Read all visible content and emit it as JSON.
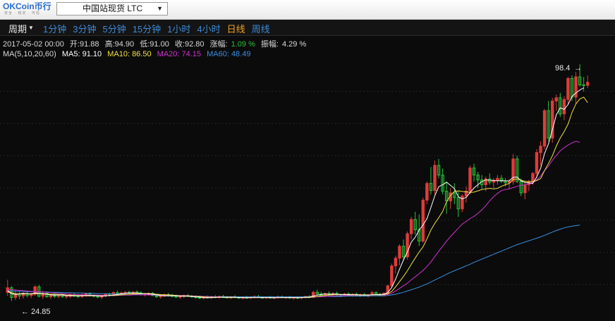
{
  "app": {
    "logo_text": "OKCoin币行",
    "logo_subtitle": "安全 · 稳定 · 可信",
    "market": "中国站现货 LTC"
  },
  "period": {
    "label": "周期",
    "tabs": [
      "1分钟",
      "3分钟",
      "5分钟",
      "15分钟",
      "1小时",
      "4小时",
      "日线",
      "周线"
    ],
    "active": "日线"
  },
  "info": {
    "datetime": "2017-05-02 00:00",
    "open_label": "开:",
    "open": "91.88",
    "high_label": "高:",
    "high": "94.90",
    "low_label": "低:",
    "low": "91.00",
    "close_label": "收:",
    "close": "92.80",
    "change_label": "涨幅:",
    "change": "1.09 %",
    "amplitude_label": "振幅:",
    "amplitude": "4.29 %"
  },
  "ma_info": {
    "header": "MA(5,10,20,60)",
    "ma5": "MA5: 91.10",
    "ma10": "MA10: 86.50",
    "ma20": "MA20: 74.15",
    "ma60": "MA60: 48.49"
  },
  "colors": {
    "up": "#e03b3b",
    "down": "#27c23a",
    "ma5": "#ffffff",
    "ma10": "#f0e040",
    "ma20": "#d030d0",
    "ma60": "#3a8fe0",
    "active_tab": "#f0a020",
    "tab": "#3d8bd8"
  },
  "chart_data": {
    "type": "candlestick",
    "ylim": [
      20,
      100
    ],
    "grid": true,
    "max_label": "98.4",
    "min_label": "24.85",
    "ohlc": [
      [
        27.5,
        31.5,
        26.5,
        29.0
      ],
      [
        29.0,
        29.5,
        24.9,
        26.0
      ],
      [
        26.0,
        28.5,
        25.2,
        27.0
      ],
      [
        27.0,
        27.8,
        25.5,
        26.5
      ],
      [
        26.5,
        27.6,
        25.6,
        27.2
      ],
      [
        27.2,
        28.0,
        26.0,
        26.6
      ],
      [
        26.6,
        27.5,
        25.8,
        27.0
      ],
      [
        27.0,
        29.8,
        26.5,
        29.3
      ],
      [
        29.3,
        29.9,
        26.0,
        26.4
      ],
      [
        26.4,
        28.0,
        25.5,
        27.3
      ],
      [
        27.3,
        27.8,
        25.9,
        26.2
      ],
      [
        26.2,
        27.0,
        25.5,
        26.6
      ],
      [
        26.6,
        27.4,
        25.8,
        26.3
      ],
      [
        26.3,
        27.0,
        25.7,
        26.8
      ],
      [
        26.8,
        27.2,
        25.9,
        26.2
      ],
      [
        26.2,
        26.9,
        25.6,
        26.4
      ],
      [
        26.4,
        27.3,
        25.8,
        26.9
      ],
      [
        26.9,
        27.4,
        26.1,
        26.5
      ],
      [
        26.5,
        26.9,
        25.8,
        26.2
      ],
      [
        26.2,
        27.2,
        25.9,
        26.8
      ],
      [
        26.8,
        27.5,
        26.2,
        27.1
      ],
      [
        27.1,
        27.6,
        26.3,
        26.6
      ],
      [
        26.6,
        27.0,
        26.0,
        26.4
      ],
      [
        26.4,
        26.8,
        25.8,
        26.1
      ],
      [
        26.1,
        26.7,
        25.5,
        26.5
      ],
      [
        26.5,
        27.2,
        26.0,
        27.0
      ],
      [
        27.0,
        27.5,
        26.3,
        26.7
      ],
      [
        26.7,
        27.9,
        26.4,
        27.5
      ],
      [
        27.5,
        28.1,
        26.8,
        27.2
      ],
      [
        27.2,
        27.8,
        26.5,
        27.4
      ],
      [
        27.4,
        28.0,
        26.9,
        27.6
      ],
      [
        27.6,
        28.1,
        27.0,
        27.3
      ],
      [
        27.3,
        27.9,
        26.8,
        27.7
      ],
      [
        27.7,
        28.2,
        27.1,
        27.4
      ],
      [
        27.4,
        27.9,
        26.6,
        26.9
      ],
      [
        26.9,
        27.4,
        26.3,
        27.0
      ],
      [
        27.0,
        27.6,
        26.5,
        27.3
      ],
      [
        27.3,
        27.7,
        26.4,
        26.6
      ],
      [
        26.6,
        27.0,
        25.9,
        26.2
      ],
      [
        26.2,
        26.8,
        25.7,
        26.5
      ],
      [
        26.5,
        27.2,
        26.1,
        26.9
      ],
      [
        26.9,
        27.4,
        26.3,
        26.7
      ],
      [
        26.7,
        27.1,
        26.0,
        26.4
      ],
      [
        26.4,
        26.9,
        25.9,
        26.1
      ],
      [
        26.1,
        26.6,
        25.6,
        26.3
      ],
      [
        26.3,
        26.9,
        25.8,
        26.6
      ],
      [
        26.6,
        27.1,
        26.1,
        26.4
      ],
      [
        26.4,
        26.8,
        25.9,
        26.2
      ],
      [
        26.2,
        26.7,
        25.7,
        26.0
      ],
      [
        26.0,
        26.5,
        25.5,
        25.8
      ],
      [
        25.8,
        26.3,
        25.4,
        26.1
      ],
      [
        26.1,
        26.6,
        25.7,
        25.9
      ],
      [
        25.9,
        26.4,
        25.5,
        26.2
      ],
      [
        26.2,
        26.7,
        25.8,
        26.0
      ],
      [
        26.0,
        26.6,
        25.6,
        26.3
      ],
      [
        26.3,
        26.8,
        25.9,
        26.1
      ],
      [
        26.1,
        26.5,
        25.7,
        25.9
      ],
      [
        25.9,
        26.4,
        25.5,
        26.2
      ],
      [
        26.2,
        26.7,
        25.8,
        26.0
      ],
      [
        26.0,
        26.4,
        25.6,
        25.8
      ],
      [
        25.8,
        26.3,
        25.4,
        26.0
      ],
      [
        26.0,
        26.5,
        25.6,
        25.9
      ],
      [
        25.9,
        26.4,
        25.5,
        26.1
      ],
      [
        26.1,
        26.6,
        25.7,
        26.3
      ],
      [
        26.3,
        26.8,
        25.9,
        26.0
      ],
      [
        26.0,
        26.4,
        25.6,
        25.9
      ],
      [
        25.9,
        26.3,
        25.5,
        26.1
      ],
      [
        26.1,
        26.5,
        25.6,
        25.8
      ],
      [
        25.8,
        26.2,
        25.4,
        26.0
      ],
      [
        26.0,
        26.6,
        25.6,
        26.2
      ],
      [
        26.2,
        26.6,
        25.8,
        25.9
      ],
      [
        25.9,
        26.3,
        25.5,
        26.1
      ],
      [
        26.1,
        26.5,
        25.6,
        25.8
      ],
      [
        25.8,
        26.2,
        25.3,
        26.0
      ],
      [
        26.0,
        26.4,
        25.5,
        25.9
      ],
      [
        25.9,
        26.3,
        25.4,
        26.1
      ],
      [
        26.1,
        26.5,
        25.7,
        26.3
      ],
      [
        26.3,
        26.7,
        25.8,
        26.0
      ],
      [
        26.0,
        28.0,
        25.8,
        27.6
      ],
      [
        27.6,
        28.4,
        26.8,
        27.1
      ],
      [
        27.1,
        27.8,
        26.5,
        26.7
      ],
      [
        26.7,
        27.5,
        26.2,
        27.2
      ],
      [
        27.2,
        27.9,
        26.7,
        26.9
      ],
      [
        26.9,
        27.6,
        26.3,
        27.3
      ],
      [
        27.3,
        27.8,
        26.6,
        26.8
      ],
      [
        26.8,
        27.2,
        26.1,
        26.5
      ],
      [
        26.5,
        27.4,
        26.2,
        27.1
      ],
      [
        27.1,
        27.6,
        26.5,
        26.7
      ],
      [
        26.7,
        27.3,
        26.2,
        27.0
      ],
      [
        27.0,
        27.5,
        26.4,
        26.6
      ],
      [
        26.6,
        27.2,
        26.1,
        26.9
      ],
      [
        26.9,
        27.4,
        26.3,
        26.5
      ],
      [
        26.5,
        27.0,
        26.0,
        26.8
      ],
      [
        26.8,
        28.0,
        26.5,
        27.5
      ],
      [
        27.5,
        27.9,
        26.8,
        27.0
      ],
      [
        27.0,
        27.4,
        26.4,
        26.6
      ],
      [
        26.6,
        27.6,
        26.3,
        27.3
      ],
      [
        27.3,
        30.0,
        27.0,
        29.6
      ],
      [
        29.6,
        36.5,
        28.8,
        35.8
      ],
      [
        35.8,
        39.0,
        33.5,
        38.2
      ],
      [
        38.2,
        42.5,
        36.0,
        41.9
      ],
      [
        41.9,
        44.0,
        37.5,
        38.6
      ],
      [
        38.6,
        46.5,
        37.8,
        45.8
      ],
      [
        45.8,
        51.0,
        44.0,
        50.2
      ],
      [
        50.2,
        52.6,
        45.5,
        47.0
      ],
      [
        47.0,
        51.8,
        42.0,
        43.5
      ],
      [
        43.5,
        57.0,
        43.0,
        56.2
      ],
      [
        56.2,
        62.0,
        55.0,
        61.4
      ],
      [
        61.4,
        66.5,
        58.0,
        59.2
      ],
      [
        59.2,
        68.5,
        58.0,
        67.0
      ],
      [
        67.0,
        69.0,
        63.0,
        64.0
      ],
      [
        64.0,
        66.0,
        58.0,
        59.0
      ],
      [
        59.0,
        62.0,
        52.0,
        56.0
      ],
      [
        56.0,
        60.0,
        53.5,
        58.5
      ],
      [
        58.5,
        61.5,
        55.0,
        57.0
      ],
      [
        57.0,
        59.0,
        51.0,
        53.5
      ],
      [
        53.5,
        58.0,
        52.5,
        57.5
      ],
      [
        57.5,
        60.5,
        55.5,
        59.0
      ],
      [
        59.0,
        67.0,
        58.0,
        66.2
      ],
      [
        66.2,
        67.5,
        62.0,
        64.0
      ],
      [
        64.0,
        65.0,
        60.0,
        62.5
      ],
      [
        62.5,
        64.0,
        59.5,
        61.0
      ],
      [
        61.0,
        63.5,
        59.0,
        62.8
      ],
      [
        62.8,
        64.5,
        61.0,
        61.8
      ],
      [
        61.8,
        63.0,
        60.0,
        62.4
      ],
      [
        62.4,
        64.0,
        61.0,
        63.0
      ],
      [
        63.0,
        64.0,
        61.5,
        62.1
      ],
      [
        62.1,
        63.0,
        60.5,
        61.6
      ],
      [
        61.6,
        62.8,
        59.8,
        62.0
      ],
      [
        62.0,
        70.5,
        61.0,
        69.0
      ],
      [
        69.0,
        70.0,
        61.5,
        62.0
      ],
      [
        62.0,
        63.0,
        57.5,
        58.5
      ],
      [
        58.5,
        62.0,
        56.5,
        61.0
      ],
      [
        61.0,
        62.5,
        59.0,
        61.8
      ],
      [
        61.8,
        65.0,
        61.0,
        64.5
      ],
      [
        64.5,
        72.0,
        63.0,
        71.0
      ],
      [
        71.0,
        74.5,
        67.0,
        73.0
      ],
      [
        73.0,
        84.5,
        72.0,
        84.0
      ],
      [
        84.0,
        87.0,
        74.5,
        75.5
      ],
      [
        75.5,
        88.0,
        74.0,
        87.0
      ],
      [
        87.0,
        89.0,
        84.0,
        88.0
      ],
      [
        88.0,
        89.5,
        82.0,
        83.0
      ],
      [
        83.0,
        88.5,
        81.0,
        87.5
      ],
      [
        87.5,
        94.5,
        86.0,
        94.0
      ],
      [
        94.0,
        95.0,
        87.0,
        88.2
      ],
      [
        88.2,
        96.0,
        86.0,
        94.5
      ],
      [
        94.5,
        98.4,
        91.5,
        92.0
      ],
      [
        92.0,
        94.5,
        90.0,
        91.9
      ],
      [
        91.88,
        94.9,
        91.0,
        92.8
      ]
    ],
    "ma5": [
      28.0,
      27.2,
      26.9,
      27.1,
      27.3,
      27.2,
      27.1,
      27.4,
      27.3,
      27.2,
      27.0,
      26.8,
      26.7,
      26.8,
      26.7,
      26.6,
      26.5,
      26.5,
      26.5,
      26.6,
      26.6,
      26.6,
      26.6,
      26.5,
      26.4,
      26.5,
      26.6,
      26.7,
      26.9,
      27.2,
      27.3,
      27.4,
      27.4,
      27.4,
      27.3,
      27.2,
      27.1,
      27.0,
      26.8,
      26.6,
      26.5,
      26.5,
      26.5,
      26.5,
      26.4,
      26.4,
      26.4,
      26.3,
      26.2,
      26.1,
      26.0,
      25.9,
      26.0,
      26.0,
      26.1,
      26.1,
      26.1,
      26.1,
      26.1,
      26.0,
      26.0,
      25.9,
      26.0,
      26.0,
      26.0,
      26.0,
      26.0,
      26.0,
      25.9,
      26.0,
      26.0,
      26.0,
      26.0,
      26.0,
      25.9,
      26.0,
      26.1,
      26.1,
      26.5,
      26.7,
      26.9,
      27.1,
      27.0,
      27.0,
      27.0,
      26.9,
      26.9,
      26.8,
      26.8,
      26.8,
      26.7,
      26.7,
      26.7,
      26.8,
      26.9,
      26.9,
      27.0,
      27.5,
      29.1,
      31.7,
      34.8,
      37.6,
      40.1,
      43.2,
      44.7,
      46.9,
      48.5,
      50.5,
      53.9,
      57.6,
      60.4,
      61.0,
      61.8,
      60.8,
      59.8,
      57.3,
      56.6,
      57.1,
      58.6,
      60.0,
      61.0,
      62.0,
      62.5,
      62.4,
      62.3,
      62.2,
      62.3,
      62.2,
      62.2,
      63.3,
      63.4,
      62.2,
      61.7,
      61.6,
      61.4,
      63.4,
      66.1,
      70.7,
      73.7,
      78.1,
      82.7,
      84.9,
      84.4,
      85.9,
      88.4,
      89.5,
      90.4,
      91.1
    ],
    "ma10": [
      28.0,
      27.5,
      27.2,
      27.1,
      27.1,
      27.2,
      27.1,
      27.2,
      27.2,
      27.1,
      27.1,
      27.0,
      27.0,
      26.9,
      26.9,
      26.7,
      26.7,
      26.6,
      26.6,
      26.6,
      26.5,
      26.5,
      26.5,
      26.5,
      26.5,
      26.5,
      26.6,
      26.6,
      26.7,
      26.8,
      26.9,
      27.0,
      27.1,
      27.1,
      27.2,
      27.2,
      27.2,
      27.1,
      27.0,
      26.9,
      26.8,
      26.8,
      26.7,
      26.6,
      26.5,
      26.5,
      26.5,
      26.4,
      26.3,
      26.3,
      26.2,
      26.1,
      26.1,
      26.1,
      26.1,
      26.0,
      26.0,
      26.0,
      26.0,
      26.0,
      26.0,
      26.0,
      26.0,
      26.0,
      26.0,
      26.0,
      26.0,
      26.0,
      26.0,
      26.0,
      26.0,
      26.0,
      26.0,
      26.0,
      26.0,
      26.0,
      26.0,
      26.0,
      26.2,
      26.3,
      26.5,
      26.6,
      26.7,
      26.8,
      26.9,
      26.9,
      26.9,
      26.9,
      26.9,
      26.9,
      26.8,
      26.8,
      26.8,
      26.8,
      26.8,
      26.8,
      26.9,
      27.1,
      27.9,
      29.3,
      30.9,
      32.5,
      34.3,
      36.3,
      38.2,
      40.1,
      41.7,
      44.2,
      46.9,
      49.0,
      50.8,
      52.7,
      55.7,
      57.7,
      58.9,
      59.1,
      58.9,
      58.8,
      58.6,
      58.7,
      59.1,
      59.5,
      59.7,
      59.9,
      59.7,
      59.9,
      60.5,
      61.0,
      61.4,
      62.7,
      62.8,
      62.4,
      62.1,
      62.0,
      62.0,
      62.3,
      62.9,
      65.4,
      67.6,
      70.0,
      73.0,
      75.5,
      77.5,
      79.8,
      83.4,
      86.1,
      87.6,
      88.2,
      86.5
    ],
    "ma20": [
      28.5,
      28.4,
      28.3,
      28.2,
      28.1,
      28.0,
      27.9,
      27.8,
      27.8,
      27.7,
      27.6,
      27.5,
      27.4,
      27.3,
      27.2,
      27.1,
      27.0,
      26.9,
      26.9,
      26.8,
      26.8,
      26.7,
      26.7,
      26.7,
      26.7,
      26.6,
      26.6,
      26.6,
      26.6,
      26.7,
      26.7,
      26.7,
      26.8,
      26.8,
      26.8,
      26.8,
      26.8,
      26.8,
      26.8,
      26.8,
      26.7,
      26.7,
      26.7,
      26.6,
      26.6,
      26.6,
      26.5,
      26.5,
      26.4,
      26.4,
      26.3,
      26.3,
      26.2,
      26.2,
      26.2,
      26.1,
      26.1,
      26.1,
      26.1,
      26.0,
      26.0,
      26.0,
      26.0,
      26.0,
      26.0,
      26.0,
      26.0,
      26.0,
      26.0,
      26.0,
      26.0,
      26.0,
      26.0,
      26.0,
      26.0,
      26.0,
      26.0,
      26.0,
      26.1,
      26.2,
      26.2,
      26.3,
      26.4,
      26.4,
      26.5,
      26.5,
      26.6,
      26.6,
      26.7,
      26.7,
      26.7,
      26.8,
      26.8,
      26.8,
      26.8,
      26.8,
      26.8,
      26.9,
      27.3,
      28.0,
      28.8,
      29.6,
      30.4,
      31.5,
      32.4,
      33.4,
      34.4,
      35.6,
      37.0,
      38.7,
      40.3,
      41.9,
      43.5,
      44.9,
      46.2,
      47.5,
      48.8,
      49.6,
      50.5,
      51.2,
      52.1,
      53.2,
      54.5,
      56.0,
      57.3,
      58.3,
      59.2,
      59.5,
      59.7,
      60.1,
      60.5,
      60.8,
      61.0,
      61.3,
      61.7,
      62.5,
      63.7,
      65.4,
      66.8,
      68.6,
      70.1,
      71.5,
      72.5,
      73.3,
      74.0,
      74.5,
      74.15
    ],
    "ma60": [
      28.0,
      28.0,
      27.9,
      27.9,
      27.9,
      27.8,
      27.8,
      27.8,
      27.7,
      27.7,
      27.7,
      27.6,
      27.6,
      27.6,
      27.5,
      27.5,
      27.5,
      27.4,
      27.4,
      27.4,
      27.3,
      27.3,
      27.3,
      27.2,
      27.2,
      27.2,
      27.1,
      27.1,
      27.1,
      27.0,
      27.0,
      27.0,
      26.9,
      26.9,
      26.9,
      26.8,
      26.8,
      26.8,
      26.7,
      26.7,
      26.7,
      26.6,
      26.6,
      26.6,
      26.5,
      26.5,
      26.5,
      26.4,
      26.4,
      26.4,
      26.3,
      26.3,
      26.3,
      26.2,
      26.2,
      26.2,
      26.2,
      26.2,
      26.2,
      26.2,
      26.2,
      26.2,
      26.2,
      26.2,
      26.2,
      26.2,
      26.2,
      26.2,
      26.2,
      26.2,
      26.2,
      26.2,
      26.2,
      26.2,
      26.2,
      26.2,
      26.2,
      26.2,
      26.3,
      26.3,
      26.3,
      26.3,
      26.3,
      26.3,
      26.3,
      26.3,
      26.4,
      26.4,
      26.4,
      26.4,
      26.4,
      26.4,
      26.4,
      26.5,
      26.5,
      26.5,
      26.5,
      26.6,
      26.8,
      27.0,
      27.3,
      27.6,
      28.0,
      28.4,
      28.8,
      29.2,
      29.7,
      30.2,
      30.8,
      31.4,
      32.0,
      32.6,
      33.2,
      33.8,
      34.3,
      34.8,
      35.3,
      35.8,
      36.3,
      36.9,
      37.4,
      37.9,
      38.4,
      38.9,
      39.4,
      39.9,
      40.4,
      40.9,
      41.4,
      41.9,
      42.4,
      42.8,
      43.2,
      43.6,
      44.0,
      44.4,
      44.8,
      45.3,
      45.8,
      46.3,
      46.8,
      47.2,
      47.6,
      47.9,
      48.1,
      48.3,
      48.49
    ]
  }
}
